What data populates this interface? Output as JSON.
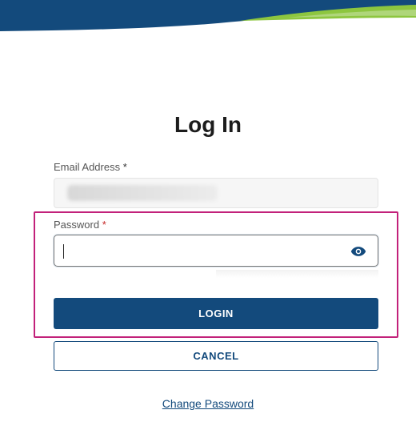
{
  "colors": {
    "brand_blue": "#134a7c",
    "accent_green": "#8dc63f",
    "highlight_magenta": "#c2217a",
    "required_red": "#c62828"
  },
  "page": {
    "title": "Log In"
  },
  "email": {
    "label": "Email Address",
    "required_mark": "*"
  },
  "password": {
    "label": "Password",
    "required_mark": "*",
    "toggle_icon": "eye-icon"
  },
  "actions": {
    "login_label": "LOGIN",
    "cancel_label": "CANCEL",
    "change_password_label": "Change Password"
  }
}
